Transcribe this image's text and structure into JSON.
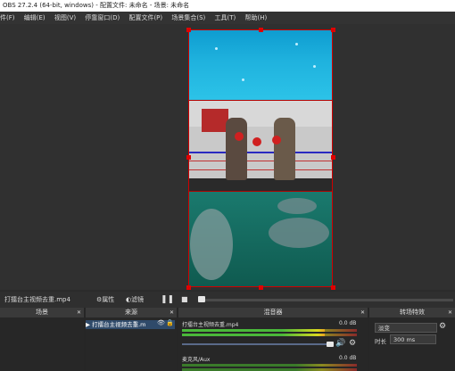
{
  "window": {
    "title": "OBS 27.2.4 (64-bit, windows) - 配置文件: 未命名 - 场景: 未命名"
  },
  "menu": {
    "items": [
      "件(F)",
      "编辑(E)",
      "视图(V)",
      "停靠窗口(D)",
      "配置文件(P)",
      "场景集合(S)",
      "工具(T)",
      "帮助(H)"
    ]
  },
  "controls": {
    "source_name": "打擂台主视频去重.mp4",
    "properties_label": "属性",
    "filters_label": "滤镜",
    "pause_icon": "pause-icon",
    "stop_icon": "stop-icon"
  },
  "docks": {
    "scenes": {
      "title": "场景"
    },
    "sources": {
      "title": "来源",
      "items": [
        "打擂台主视频去重.m"
      ]
    },
    "mixer": {
      "title": "混音器",
      "channels": [
        {
          "name": "打擂台主视频去重.mp4",
          "db": "0.0 dB"
        },
        {
          "name": "麦克风/Aux",
          "db": "0.0 dB"
        }
      ]
    },
    "transitions": {
      "title": "转场特效",
      "selected": "淡变",
      "duration_label": "时长",
      "duration_value": "300 ms"
    }
  },
  "icons": [
    "gear-icon",
    "filter-icon",
    "eye-icon",
    "lock-icon",
    "speaker-icon",
    "close-icon"
  ],
  "colors": {
    "selection": "#d00000",
    "selected_row": "#2f4a6a"
  }
}
